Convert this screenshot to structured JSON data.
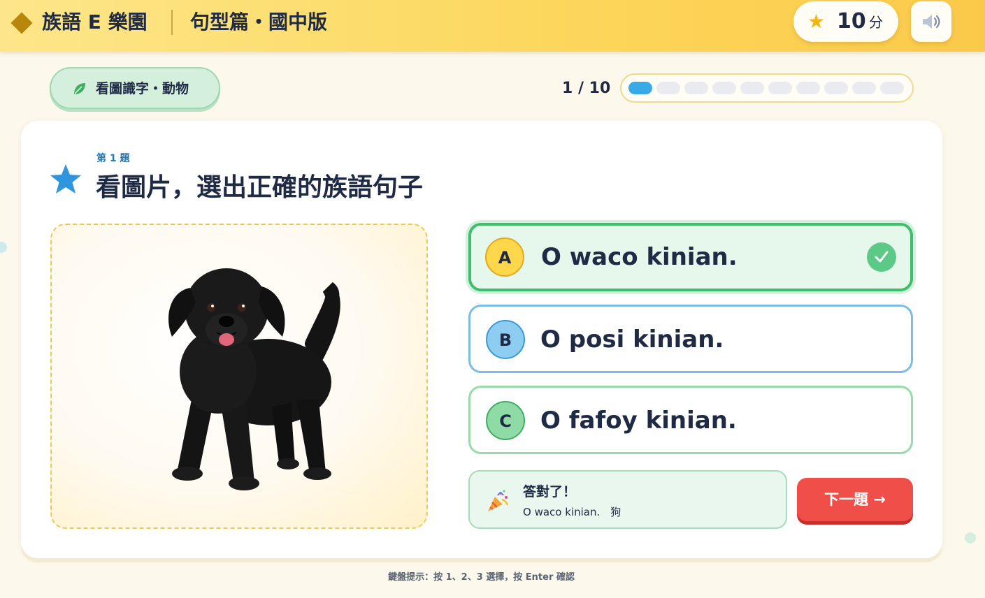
{
  "header": {
    "app_title": "族語 E 樂園",
    "subtitle": "句型篇・國中版",
    "score": {
      "value": "10",
      "unit": "分",
      "icon": "star-icon"
    },
    "sound_icon": "speaker-icon"
  },
  "category": {
    "label": "看圖識字・動物",
    "icon": "leaf-icon"
  },
  "progress": {
    "text": "1 / 10",
    "current": 1,
    "total": 10
  },
  "question": {
    "number_label": "第 1 題",
    "prompt": "看圖片，選出正確的族語句子",
    "image": "black-puppy-illustration"
  },
  "options": [
    {
      "key": "A",
      "text": "O waco kinian.",
      "state": "correct"
    },
    {
      "key": "B",
      "text": "O posi kinian.",
      "state": "default"
    },
    {
      "key": "C",
      "text": "O fafoy kinian.",
      "state": "default"
    }
  ],
  "feedback": {
    "icon": "party-popper-icon",
    "title": "答對了！",
    "detail": "O waco kinian.　狗"
  },
  "next_button": {
    "label": "下一題 →"
  },
  "keyboard_hint": "鍵盤提示：按 1、2、3 選擇，按 Enter 確認",
  "colors": {
    "header_bg": "#fcd65a",
    "correct": "#3fbf6b",
    "option_b": "#7bbde6",
    "option_c": "#97dbaa",
    "next_button": "#ef4f48",
    "progress_active": "#3aa9e8"
  }
}
